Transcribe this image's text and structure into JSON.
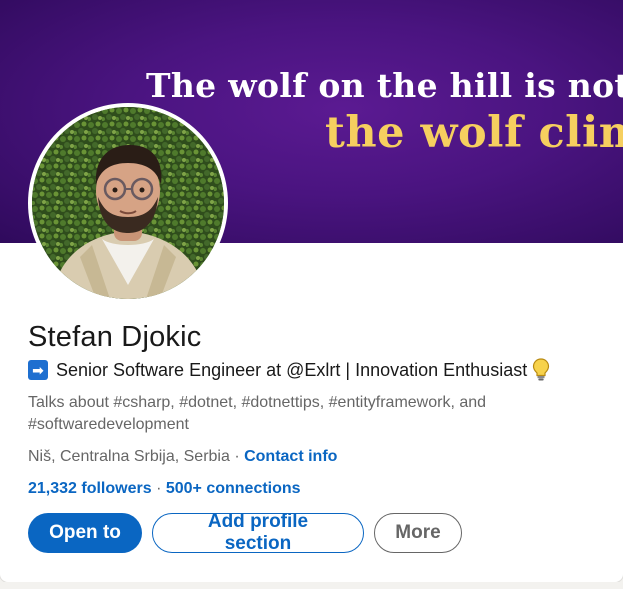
{
  "banner": {
    "line1": "The wolf on the hill is not as",
    "line2": "the wolf climb"
  },
  "profile": {
    "name": "Stefan Djokic",
    "headline_icon": "➡",
    "headline": "Senior Software Engineer at @Exlrt | Innovation Enthusiast",
    "headline_end_icon": "lightbulb-icon",
    "talks_about": "Talks about #csharp, #dotnet, #dotnettips, #entityframework, and #softwaredevelopment",
    "location": "Niš, Centralna Srbija, Serbia",
    "location_separator": " · ",
    "contact_info": "Contact info",
    "followers": "21,332 followers",
    "network_separator": " · ",
    "connections": "500+ connections"
  },
  "actions": {
    "open_to": "Open to",
    "add_profile_section": "Add profile section",
    "more": "More"
  },
  "colors": {
    "brand_blue": "#0a66c2",
    "banner_purple": "#4a1480",
    "banner_gold": "#f6cf5f",
    "text_primary": "#191919",
    "text_secondary": "#666666"
  }
}
